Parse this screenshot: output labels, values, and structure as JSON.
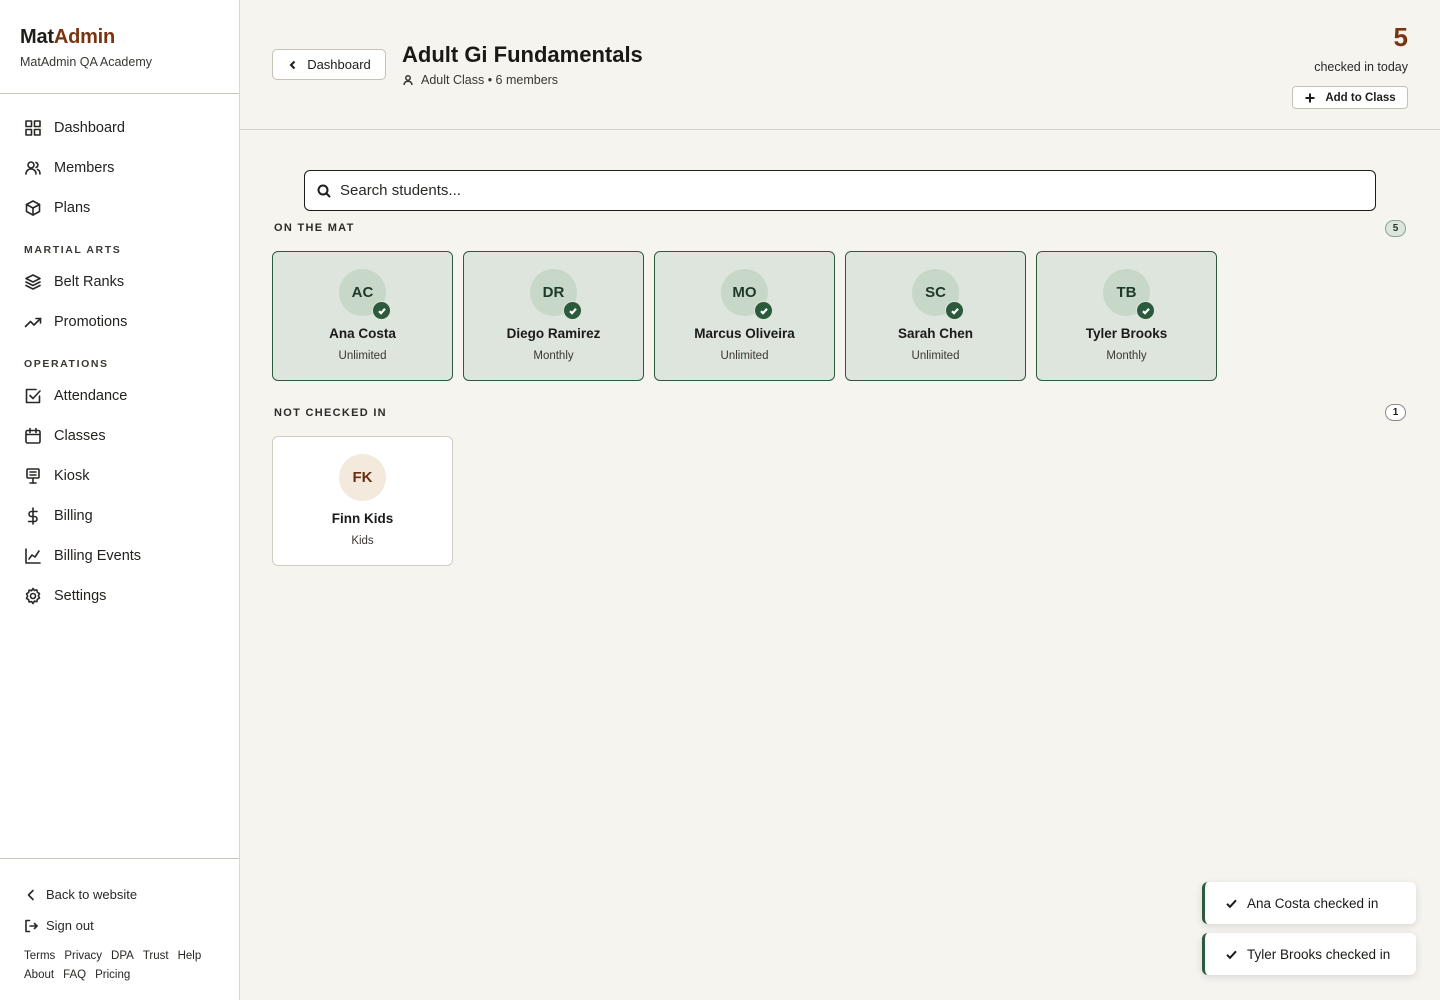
{
  "brand": {
    "name_part1": "Mat",
    "name_part2": "Admin",
    "academy": "MatAdmin QA Academy"
  },
  "sidebar": {
    "main_items": [
      {
        "label": "Dashboard",
        "icon": "grid-icon"
      },
      {
        "label": "Members",
        "icon": "users-icon"
      },
      {
        "label": "Plans",
        "icon": "box-icon"
      }
    ],
    "martial_arts_title": "MARTIAL ARTS",
    "martial_arts_items": [
      {
        "label": "Belt Ranks",
        "icon": "layers-icon"
      },
      {
        "label": "Promotions",
        "icon": "trending-up-icon"
      }
    ],
    "operations_title": "OPERATIONS",
    "operations_items": [
      {
        "label": "Attendance",
        "icon": "check-square-icon"
      },
      {
        "label": "Classes",
        "icon": "calendar-icon"
      },
      {
        "label": "Kiosk",
        "icon": "kiosk-icon"
      },
      {
        "label": "Billing",
        "icon": "dollar-icon"
      },
      {
        "label": "Billing Events",
        "icon": "chart-icon"
      },
      {
        "label": "Settings",
        "icon": "gear-icon"
      }
    ],
    "back_to_website": "Back to website",
    "sign_out": "Sign out",
    "footer_links": [
      "Terms",
      "Privacy",
      "DPA",
      "Trust",
      "Help",
      "About",
      "FAQ",
      "Pricing"
    ]
  },
  "header": {
    "back_label": "Dashboard",
    "title": "Adult Gi Fundamentals",
    "subtitle": "Adult Class • 6 members",
    "checked_in_count": "5",
    "checked_in_label": "checked in today",
    "add_label": "Add to Class"
  },
  "search": {
    "placeholder": "Search students..."
  },
  "on_mat": {
    "title": "ON THE MAT",
    "count": "5",
    "students": [
      {
        "initials": "AC",
        "name": "Ana Costa",
        "plan": "Unlimited"
      },
      {
        "initials": "DR",
        "name": "Diego Ramirez",
        "plan": "Monthly"
      },
      {
        "initials": "MO",
        "name": "Marcus Oliveira",
        "plan": "Unlimited"
      },
      {
        "initials": "SC",
        "name": "Sarah Chen",
        "plan": "Unlimited"
      },
      {
        "initials": "TB",
        "name": "Tyler Brooks",
        "plan": "Monthly"
      }
    ]
  },
  "not_checked": {
    "title": "NOT CHECKED IN",
    "count": "1",
    "students": [
      {
        "initials": "FK",
        "name": "Finn Kids",
        "plan": "Kids"
      }
    ]
  },
  "toasts": [
    "Ana Costa checked in",
    "Tyler Brooks checked in"
  ],
  "colors": {
    "accent_brown": "#7a3410",
    "checked_green": "#2c5a3c",
    "checked_bg": "#dde5dc",
    "page_bg": "#f6f4ef"
  }
}
